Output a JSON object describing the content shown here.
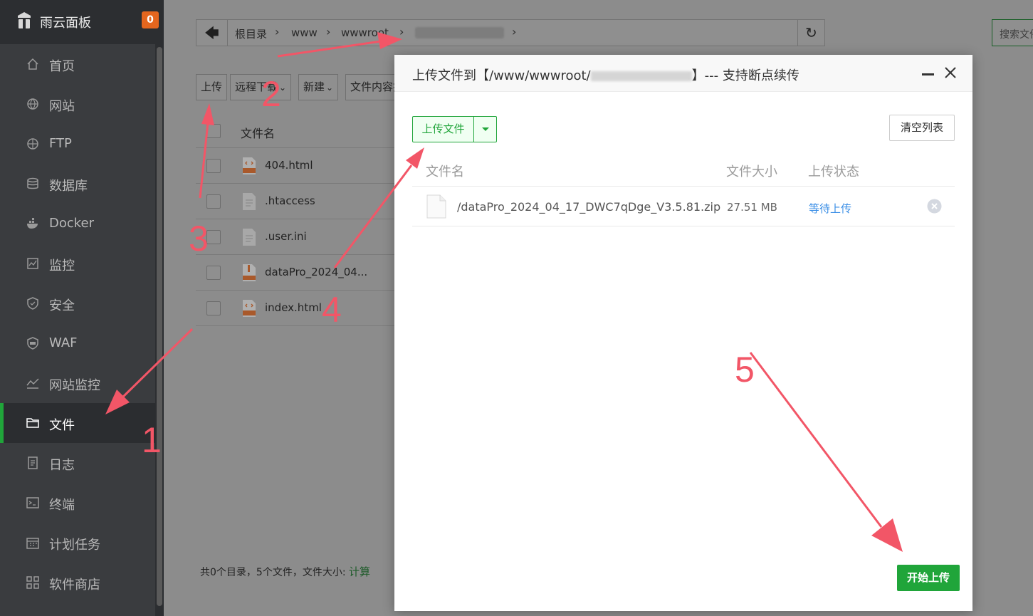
{
  "brand": {
    "name": "雨云面板",
    "badge": "0"
  },
  "sidebar": {
    "items": [
      {
        "label": "首页",
        "icon": "home-icon"
      },
      {
        "label": "网站",
        "icon": "globe-icon"
      },
      {
        "label": "FTP",
        "icon": "ftp-icon"
      },
      {
        "label": "数据库",
        "icon": "database-icon"
      },
      {
        "label": "Docker",
        "icon": "docker-icon"
      },
      {
        "label": "监控",
        "icon": "monitor-icon"
      },
      {
        "label": "安全",
        "icon": "shield-icon"
      },
      {
        "label": "WAF",
        "icon": "waf-icon"
      },
      {
        "label": "网站监控",
        "icon": "chart-line-icon"
      },
      {
        "label": "文件",
        "icon": "folder-icon",
        "active": true
      },
      {
        "label": "日志",
        "icon": "log-icon"
      },
      {
        "label": "终端",
        "icon": "terminal-icon"
      },
      {
        "label": "计划任务",
        "icon": "calendar-icon"
      },
      {
        "label": "软件商店",
        "icon": "apps-icon"
      }
    ]
  },
  "path": {
    "crumbs": [
      "根目录",
      "www",
      "wwwroot"
    ]
  },
  "search": {
    "placeholder": "搜索文件"
  },
  "toolbar": {
    "upload": "上传",
    "remote_download": "远程下载",
    "new": "新建",
    "content_search": "文件内容搜"
  },
  "file_list": {
    "header": "文件名",
    "files": [
      {
        "name": "404.html",
        "type": "html"
      },
      {
        "name": ".htaccess",
        "type": "text"
      },
      {
        "name": ".user.ini",
        "type": "text"
      },
      {
        "name": "dataPro_2024_04...",
        "type": "zip"
      },
      {
        "name": "index.html",
        "type": "html"
      }
    ],
    "summary_text": "共0个目录，5个文件，文件大小: ",
    "summary_link": "计算"
  },
  "modal": {
    "title_prefix": "上传文件到【/www/wwwroot/",
    "title_suffix": "】--- 支持断点续传",
    "upload_button": "上传文件",
    "clear_button": "清空列表",
    "columns": [
      "文件名",
      "文件大小",
      "上传状态"
    ],
    "rows": [
      {
        "name": "/dataPro_2024_04_17_DWC7qDge_V3.5.81.zip",
        "size": "27.51 MB",
        "status": "等待上传"
      }
    ],
    "start_button": "开始上传"
  },
  "annotations": [
    "1",
    "2",
    "3",
    "4",
    "5"
  ],
  "colors": {
    "accent": "#20a53a",
    "annotation": "#f25667",
    "badge": "#e5661e",
    "link": "#3a8ee6"
  }
}
